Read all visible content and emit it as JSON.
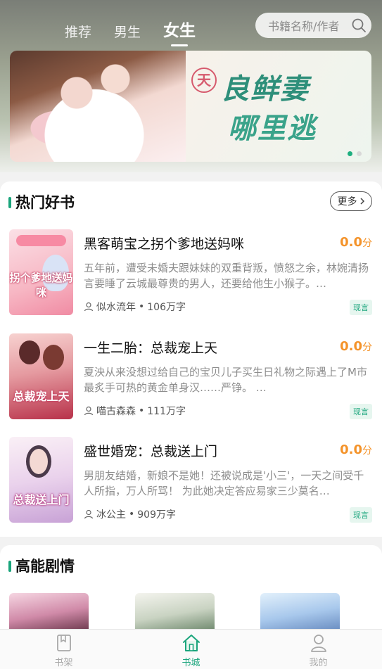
{
  "tabs": [
    {
      "label": "推荐",
      "active": false
    },
    {
      "label": "男生",
      "active": false
    },
    {
      "label": "女生",
      "active": true
    }
  ],
  "search": {
    "placeholder": "书籍名称/作者",
    "icon": "search-icon"
  },
  "banner": {
    "title_line1": "良鲜妻",
    "title_line2": "哪里逃",
    "circle_text": "天",
    "slides": 2,
    "active_slide": 1
  },
  "hot_section": {
    "title": "热门好书",
    "more_label": "更多",
    "books": [
      {
        "title": "黑客萌宝之拐个爹地送妈咪",
        "score": "0.0",
        "score_unit": "分",
        "desc": "五年前，遭受未婚夫跟妹妹的双重背叛，愤怒之余，林婉清扬言要睡了云城最尊贵的男人，还要给他生小猴子。…",
        "author": "似水流年",
        "words": "106万字",
        "tag": "现言",
        "cover_text": "拐个爹地送妈咪",
        "cover_colors": [
          "#f9c7cf",
          "#f4a4b5"
        ]
      },
      {
        "title": "一生二胎：总裁宠上天",
        "score": "0.0",
        "score_unit": "分",
        "desc": "夏泱从来没想过给自己的宝贝儿子买生日礼物之际遇上了M市最炙手可热的黄金单身汉……严铮。 …",
        "author": "喵古森森",
        "words": "111万字",
        "tag": "现言",
        "cover_text": "总裁宠上天",
        "cover_colors": [
          "#e8a0a4",
          "#b0324a"
        ]
      },
      {
        "title": "盛世婚宠：总裁送上门",
        "score": "0.0",
        "score_unit": "分",
        "desc": "男朋友结婚，新娘不是她！还被说成是'小三'，一天之间受千人所指，万人所骂！ 为此她决定答应易家三少莫名…",
        "author": "冰公主",
        "words": "909万字",
        "tag": "现言",
        "cover_text": "总裁送上门",
        "cover_colors": [
          "#f4e8f4",
          "#caa6d8"
        ]
      }
    ]
  },
  "plot_section": {
    "title": "高能剧情",
    "thumb_colors": [
      [
        "#e8c6d4",
        "#6b2d3c"
      ],
      [
        "#f1f1ea",
        "#5d7a5d"
      ],
      [
        "#d6e8f6",
        "#5c80b8"
      ]
    ]
  },
  "navbar": [
    {
      "label": "书架",
      "icon": "bookshelf-icon",
      "active": false
    },
    {
      "label": "书城",
      "icon": "home-icon",
      "active": true
    },
    {
      "label": "我的",
      "icon": "profile-icon",
      "active": false
    }
  ],
  "colors": {
    "accent": "#1aa57c",
    "score": "#f4932a"
  }
}
